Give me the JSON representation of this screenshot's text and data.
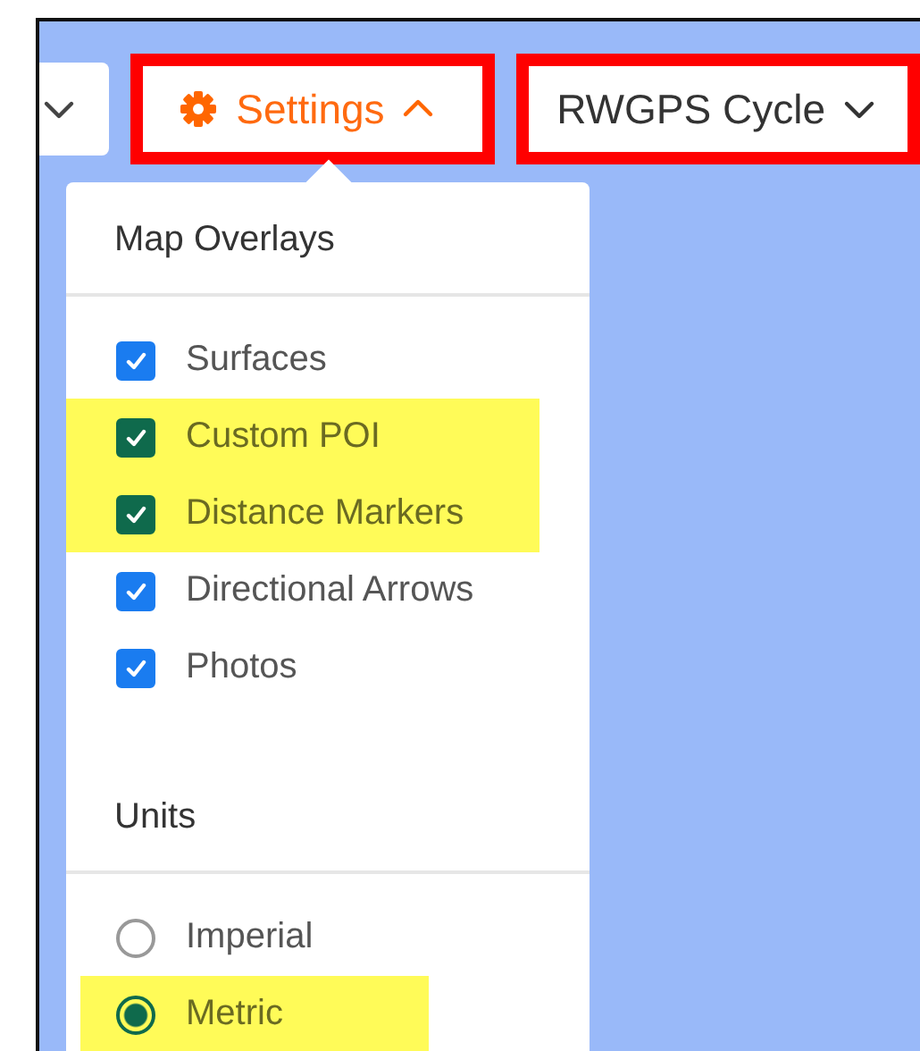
{
  "toolbar": {
    "left_button": {
      "kind": "chevron-only"
    },
    "settings_button": {
      "label": "Settings",
      "expanded": true,
      "outlined": true
    },
    "map_style_button": {
      "label": "RWGPS Cycle",
      "expanded": false,
      "outlined": true
    }
  },
  "settings_menu": {
    "sections": [
      {
        "title": "Map Overlays",
        "kind": "checkbox",
        "items": [
          {
            "label": "Surfaces",
            "checked": true,
            "highlighted": false
          },
          {
            "label": "Custom POI",
            "checked": true,
            "highlighted": true
          },
          {
            "label": "Distance Markers",
            "checked": true,
            "highlighted": true
          },
          {
            "label": "Directional Arrows",
            "checked": true,
            "highlighted": false
          },
          {
            "label": "Photos",
            "checked": true,
            "highlighted": false
          }
        ]
      },
      {
        "title": "Units",
        "kind": "radio",
        "items": [
          {
            "label": "Imperial",
            "selected": false,
            "highlighted": false
          },
          {
            "label": "Metric",
            "selected": true,
            "highlighted": true
          }
        ]
      }
    ]
  }
}
